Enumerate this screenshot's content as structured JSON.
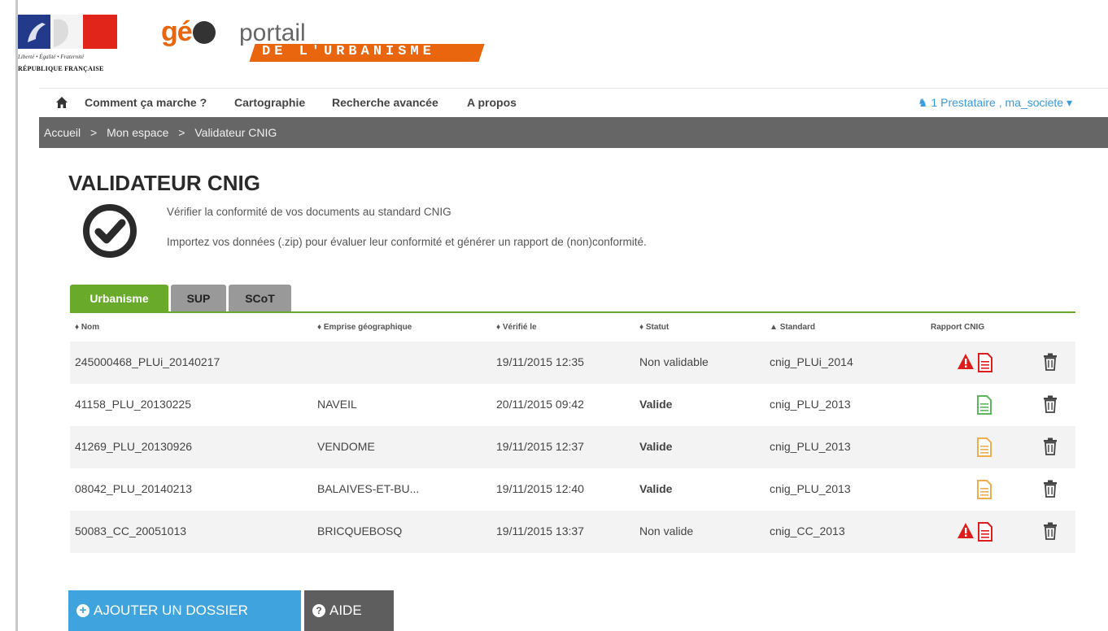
{
  "header": {
    "republic_motto": "Liberté • Égalité • Fraternité",
    "republic_name": "RÉPUBLIQUE FRANÇAISE",
    "brand_geo": "gé",
    "brand_portail": "portail",
    "brand_subtitle": "DE L'URBANISME",
    "brand_color": "#e9660f"
  },
  "nav": {
    "home_icon": "home-icon",
    "items": [
      "Comment ça marche ?",
      "Cartographie",
      "Recherche avancée",
      "A propos"
    ],
    "user": "1 Prestataire , ma_societe"
  },
  "breadcrumb": [
    "Accueil",
    "Mon espace",
    "Validateur CNIG"
  ],
  "page": {
    "title": "VALIDATEUR CNIG",
    "desc1": "Vérifier la conformité de vos documents au standard CNIG",
    "desc2": "Importez vos données (.zip) pour évaluer leur conformité et générer un rapport de (non)conformité."
  },
  "tabs": [
    {
      "label": "Urbanisme",
      "active": true
    },
    {
      "label": "SUP",
      "active": false
    },
    {
      "label": "SCoT",
      "active": false
    }
  ],
  "table": {
    "headers": [
      "Nom",
      "Emprise géographique",
      "Vérifié le",
      "Statut",
      "Standard",
      "Rapport CNIG"
    ],
    "rows": [
      {
        "nom": "245000468_PLUi_20140217",
        "emprise": "",
        "verifie": "19/11/2015 12:35",
        "statut": "Non validable",
        "standard": "cnig_PLUi_2014",
        "report": "error"
      },
      {
        "nom": "41158_PLU_20130225",
        "emprise": "NAVEIL",
        "verifie": "20/11/2015 09:42",
        "statut": "Valide",
        "standard": "cnig_PLU_2013",
        "report": "valid"
      },
      {
        "nom": "41269_PLU_20130926",
        "emprise": "VENDOME",
        "verifie": "19/11/2015 12:37",
        "statut": "Valide",
        "standard": "cnig_PLU_2013",
        "report": "warning"
      },
      {
        "nom": "08042_PLU_20140213",
        "emprise": "BALAIVES-ET-BU...",
        "verifie": "19/11/2015 12:40",
        "statut": "Valide",
        "standard": "cnig_PLU_2013",
        "report": "warning"
      },
      {
        "nom": "50083_CC_20051013",
        "emprise": "BRICQUEBOSQ",
        "verifie": "19/11/2015 13:37",
        "statut": "Non valide",
        "standard": "cnig_CC_2013",
        "report": "error"
      }
    ]
  },
  "buttons": {
    "add": "AJOUTER UN DOSSIER",
    "help": "AIDE"
  },
  "colors": {
    "accent_green": "#6aaa2b",
    "button_blue": "#3fa4dd",
    "error_red": "#e01b1b",
    "valid_green": "#5cb85c",
    "warning_orange": "#f0ad4e"
  }
}
